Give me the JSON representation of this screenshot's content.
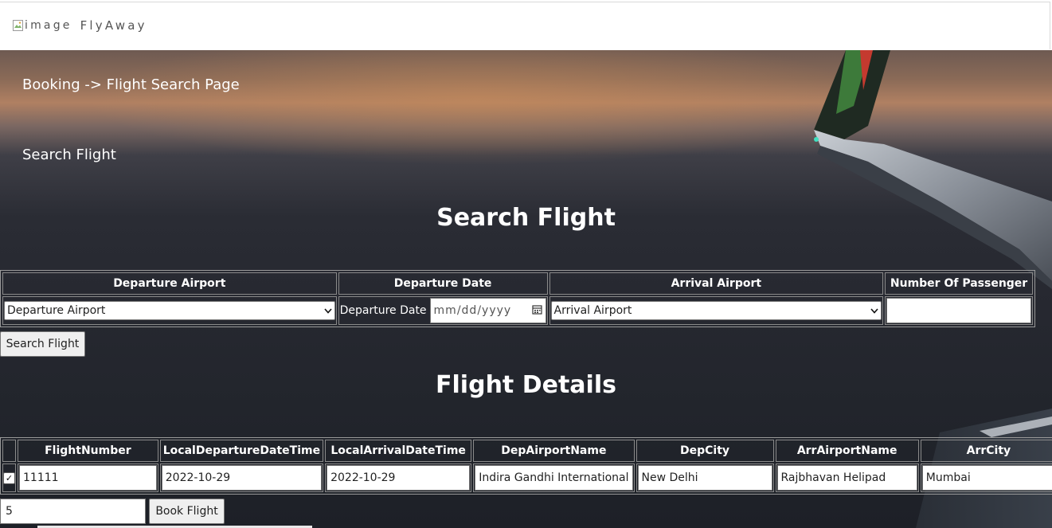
{
  "header": {
    "logo_alt": "image",
    "brand": "FlyAway"
  },
  "breadcrumb": "Booking -> Flight Search Page",
  "subheading": "Search Flight",
  "search": {
    "title": "Search Flight",
    "columns": [
      "Departure Airport",
      "Departure Date",
      "Arrival Airport",
      "Number Of Passenger"
    ],
    "departure_airport_selected": "Departure Airport",
    "departure_date_label": "Departure Date",
    "departure_date_placeholder": "mm/dd/yyyy",
    "arrival_airport_selected": "Arrival Airport",
    "passengers_value": "",
    "button_label": "Search Flight"
  },
  "details": {
    "title": "Flight Details",
    "columns": [
      "FlightNumber",
      "LocalDepartureDateTime",
      "LocalArrivalDateTime",
      "DepAirportName",
      "DepCity",
      "ArrAirportName",
      "ArrCity"
    ],
    "rows": [
      {
        "selected": true,
        "cells": [
          "11111",
          "2022-10-29",
          "2022-10-29",
          "Indira Gandhi International",
          "New Delhi",
          "Rajbhavan Helipad",
          "Mumbai"
        ]
      }
    ]
  },
  "booking": {
    "quantity_value": "5",
    "button_label": "Book Flight"
  },
  "icons": {
    "select_arrow": "chevron-down-icon",
    "calendar": "calendar-icon",
    "checkbox": "checkbox-icon",
    "broken_image": "broken-image-icon"
  }
}
